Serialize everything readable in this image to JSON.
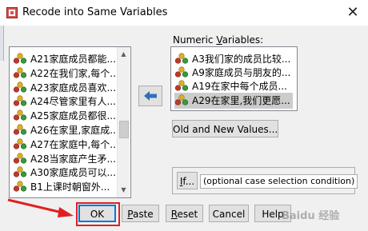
{
  "window": {
    "title": "Recode into Same Variables",
    "close_glyph": "✕"
  },
  "source_list": {
    "items": [
      {
        "label": "A21家庭成员都能..."
      },
      {
        "label": "A22在我们家,每个..."
      },
      {
        "label": "A23家庭成员喜欢..."
      },
      {
        "label": "A24尽管家里有人..."
      },
      {
        "label": "A25家庭成员都很..."
      },
      {
        "label": "A26在家里,家庭成..."
      },
      {
        "label": "A27在家庭中,每个..."
      },
      {
        "label": "A28当家庭产生矛..."
      },
      {
        "label": "A30家庭成员可以..."
      },
      {
        "label": "B1上课时朝窗外..."
      }
    ]
  },
  "move_button": {
    "icon": "arrow-left-icon"
  },
  "numeric_variables": {
    "label_before": "Numeric ",
    "label_mnemonic": "V",
    "label_after": "ariables:",
    "items": [
      {
        "label": "A3我们家的成员比较..."
      },
      {
        "label": "A9家庭成员与朋友的..."
      },
      {
        "label": "A19在家中每个成员..."
      },
      {
        "label": "A29在家里,我们更愿...",
        "selected": true
      }
    ]
  },
  "buttons": {
    "old_new_values": "Old and New Values...",
    "if_mnemonic": "I",
    "if_rest": "f...",
    "if_condition": "(optional case selection condition)",
    "ok": "OK",
    "paste_mnemonic": "P",
    "paste_rest": "aste",
    "reset_mnemonic": "R",
    "reset_rest": "eset",
    "cancel": "Cancel",
    "help": "Help"
  },
  "watermark": "Baidu 经验",
  "colors": {
    "annotation_red": "#e02020",
    "variable_icon_red": "#c0392b",
    "variable_icon_green": "#3a9a3a",
    "variable_icon_yellow": "#e0b020",
    "arrow_blue": "#2f6fba"
  }
}
